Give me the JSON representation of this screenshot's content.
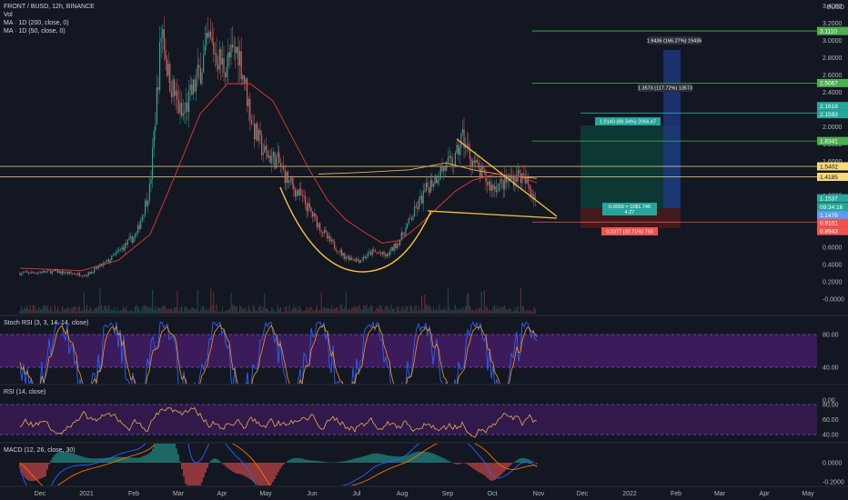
{
  "header": {
    "symbol": "FRONT / BUSD, 12h, BINANCE",
    "indicators": [
      "Vol",
      "MA · 1D (200, close, 0)",
      "MA · 1D (50, close, 0)"
    ],
    "currency": "BUSD"
  },
  "panes": {
    "stoch_rsi": "Stoch RSI (3, 3, 14, 14, close)",
    "rsi": "RSI (14, close)",
    "macd": "MACD (12, 26, close, 30)"
  },
  "x_axis": {
    "labels": [
      "Dec",
      "2021",
      "Feb",
      "Mar",
      "Apr",
      "May",
      "Jun",
      "Jul",
      "Aug",
      "Sep",
      "Oct",
      "Nov",
      "Dec",
      "2022",
      "Feb",
      "Mar",
      "Apr",
      "May"
    ]
  },
  "price_axis": {
    "ticks": [
      "3.4000",
      "3.2000",
      "3.0000",
      "2.8000",
      "2.6000",
      "2.4000",
      "2.2000",
      "2.0000",
      "1.8000",
      "1.6000",
      "1.4000",
      "1.2000",
      "1.0000",
      "0.8000",
      "0.6000",
      "0.4000",
      "0.2000",
      "-0.0000"
    ]
  },
  "price_tags": [
    {
      "label": "3.1110",
      "color": "#4caf50",
      "text_color": "#ffffff"
    },
    {
      "label": "2.5067",
      "color": "#4caf50",
      "text_color": "#ffffff"
    },
    {
      "label": "2.1618",
      "color": "#26a69a",
      "text_color": "#ffffff"
    },
    {
      "label": "2.1593",
      "color": "#26a69a",
      "text_color": "#ffffff"
    },
    {
      "label": "1.8341",
      "color": "#4caf50",
      "text_color": "#ffffff"
    },
    {
      "label": "1.5402",
      "color": "#f5d97b",
      "text_color": "#131722"
    },
    {
      "label": "1.4185",
      "color": "#f5d97b",
      "text_color": "#131722"
    },
    {
      "label": "1.1537",
      "color": "#26a69a",
      "text_color": "#ffffff"
    },
    {
      "label": "09:34:16",
      "color": "#26a69a",
      "text_color": "#ffffff"
    },
    {
      "label": "1.1478",
      "color": "#5b9cf6",
      "text_color": "#ffffff"
    },
    {
      "label": "0.9101",
      "color": "#ef5350",
      "text_color": "#ffffff"
    },
    {
      "label": "0.8943",
      "color": "#ef5350",
      "text_color": "#ffffff"
    }
  ],
  "osc_axis": {
    "stoch": [
      "80.00",
      "40.00",
      "0.00"
    ],
    "rsi": [
      "80.00",
      "60.00",
      "40.00"
    ],
    "macd": [
      "0.0000",
      "-0.2000"
    ]
  },
  "annotations": {
    "target3": "1.9436 (166.27%) 19436",
    "target2": "1.3573 (117.72%) 13573",
    "position_profit": "1.0140 (88.34%) 2066.47",
    "position_mid1": "0.0059 = 10$1.746",
    "position_mid2": "4.27",
    "position_loss": "0.2377 (20.71%) 750"
  },
  "colors": {
    "background": "#131722",
    "candle_up": "#26a69a",
    "candle_down": "#ef5350",
    "ma200": "#e6b04a",
    "ma50": "#e53935",
    "pattern": "#f5c542",
    "stoch_k": "#2962ff",
    "stoch_d": "#ff9800",
    "stoch_band": "#7e57c2",
    "rsi_line": "#e6b04a",
    "macd_line": "#2962ff",
    "signal_line": "#ff6d00",
    "target_line": "#4caf50",
    "stop_line": "#ef5350"
  }
}
